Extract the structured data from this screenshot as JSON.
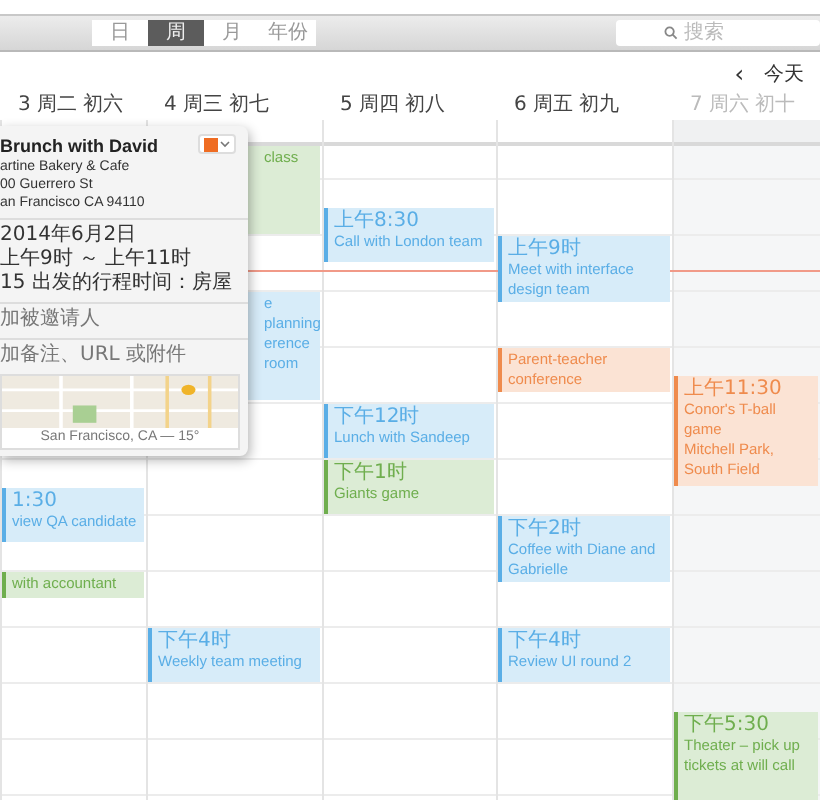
{
  "toolbar": {
    "views": [
      {
        "label": "日",
        "selected": false
      },
      {
        "label": "周",
        "selected": true
      },
      {
        "label": "月",
        "selected": false
      },
      {
        "label": "年份",
        "selected": false
      }
    ],
    "search": {
      "placeholder": "搜索"
    }
  },
  "nav": {
    "prev": "‹",
    "today": "今天"
  },
  "days": [
    {
      "label": "3 周二 初六",
      "weekend": false,
      "events": [
        {
          "time": "1:30",
          "title": "view QA candidate",
          "color": "#5aaee6"
        },
        {
          "title": "with accountant",
          "color": "#6fae4e"
        }
      ]
    },
    {
      "label": "4 周三 初七",
      "weekend": false,
      "events": [
        {
          "title": "class",
          "color": "#6fae4e"
        },
        {
          "title": "e planning",
          "location": "erence room",
          "color": "#5aaee6"
        },
        {
          "time": "下午4时",
          "title": "Weekly team meeting",
          "color": "#5aaee6"
        }
      ]
    },
    {
      "label": "5 周四 初八",
      "weekend": false,
      "events": [
        {
          "time": "上午8:30",
          "title": "Call with London team",
          "color": "#5aaee6"
        },
        {
          "time": "下午12时",
          "title": "Lunch with Sandeep",
          "color": "#5aaee6"
        },
        {
          "time": "下午1时",
          "title": "Giants game",
          "color": "#6fae4e"
        }
      ]
    },
    {
      "label": "6 周五 初九",
      "weekend": false,
      "events": [
        {
          "time": "上午9时",
          "title": "Meet with interface design team",
          "color": "#5aaee6"
        },
        {
          "title": "Parent-teacher conference",
          "color": "#ef8b4d"
        },
        {
          "time": "下午2时",
          "title": "Coffee with Diane and Gabrielle",
          "color": "#5aaee6"
        },
        {
          "time": "下午4时",
          "title": "Review UI round 2",
          "color": "#5aaee6"
        }
      ]
    },
    {
      "label": "7 周六 初十",
      "weekend": true,
      "events": [
        {
          "time": "上午11:30",
          "title": "Conor's T-ball game",
          "location": "Mitchell Park, South Field",
          "color": "#ef8b4d"
        },
        {
          "time": "下午5:30",
          "title": "Theater – pick up tickets at will call",
          "color": "#6fae4e"
        }
      ]
    }
  ],
  "popover": {
    "title": "Brunch with David",
    "color": "#ef6c22",
    "address": [
      "artine Bakery & Cafe",
      "00 Guerrero St",
      "an Francisco CA 94110"
    ],
    "date": "2014年6月2日",
    "time": "上午9时 ～ 上午11时",
    "travel": "15 出发的行程时间：房屋",
    "invitees": "加被邀请人",
    "notes": "加备注、URL 或附件",
    "map_caption": "San Francisco, CA — 15°"
  }
}
